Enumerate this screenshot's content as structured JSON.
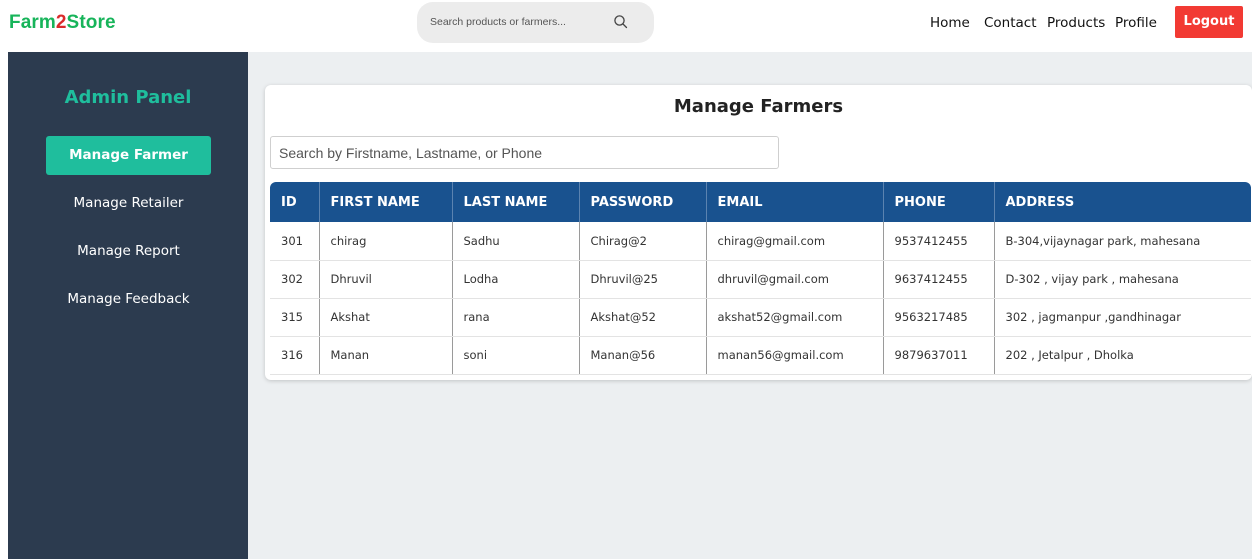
{
  "brand": {
    "part1": "Farm",
    "part2": "2",
    "part3": "Store"
  },
  "search": {
    "placeholder": "Search products or farmers..."
  },
  "nav": {
    "home": "Home",
    "contact": "Contact",
    "products": "Products",
    "profile": "Profile",
    "logout": "Logout"
  },
  "sidebar": {
    "title": "Admin Panel",
    "items": [
      {
        "label": "Manage Farmer"
      },
      {
        "label": "Manage Retailer"
      },
      {
        "label": "Manage Report"
      },
      {
        "label": "Manage Feedback"
      }
    ]
  },
  "main": {
    "title": "Manage Farmers",
    "search_placeholder": "Search by Firstname, Lastname, or Phone",
    "columns": [
      "ID",
      "FIRST NAME",
      "LAST NAME",
      "PASSWORD",
      "EMAIL",
      "PHONE",
      "ADDRESS"
    ],
    "rows": [
      [
        "301",
        "chirag",
        "Sadhu",
        "Chirag@2",
        "chirag@gmail.com",
        "9537412455",
        "B-304,vijaynagar park, mahesana"
      ],
      [
        "302",
        "Dhruvil",
        "Lodha",
        "Dhruvil@25",
        "dhruvil@gmail.com",
        "9637412455",
        "D-302 , vijay park , mahesana"
      ],
      [
        "315",
        "Akshat",
        "rana",
        "Akshat@52",
        "akshat52@gmail.com",
        "9563217485",
        "302 , jagmanpur ,gandhinagar"
      ],
      [
        "316",
        "Manan",
        "soni",
        "Manan@56",
        "manan56@gmail.com",
        "9879637011",
        "202 , Jetalpur , Dholka"
      ]
    ]
  },
  "colors": {
    "accent": "#1fbe9d",
    "sidebar": "#2c3b4f",
    "table_header": "#19528f",
    "logout": "#f23a33"
  }
}
